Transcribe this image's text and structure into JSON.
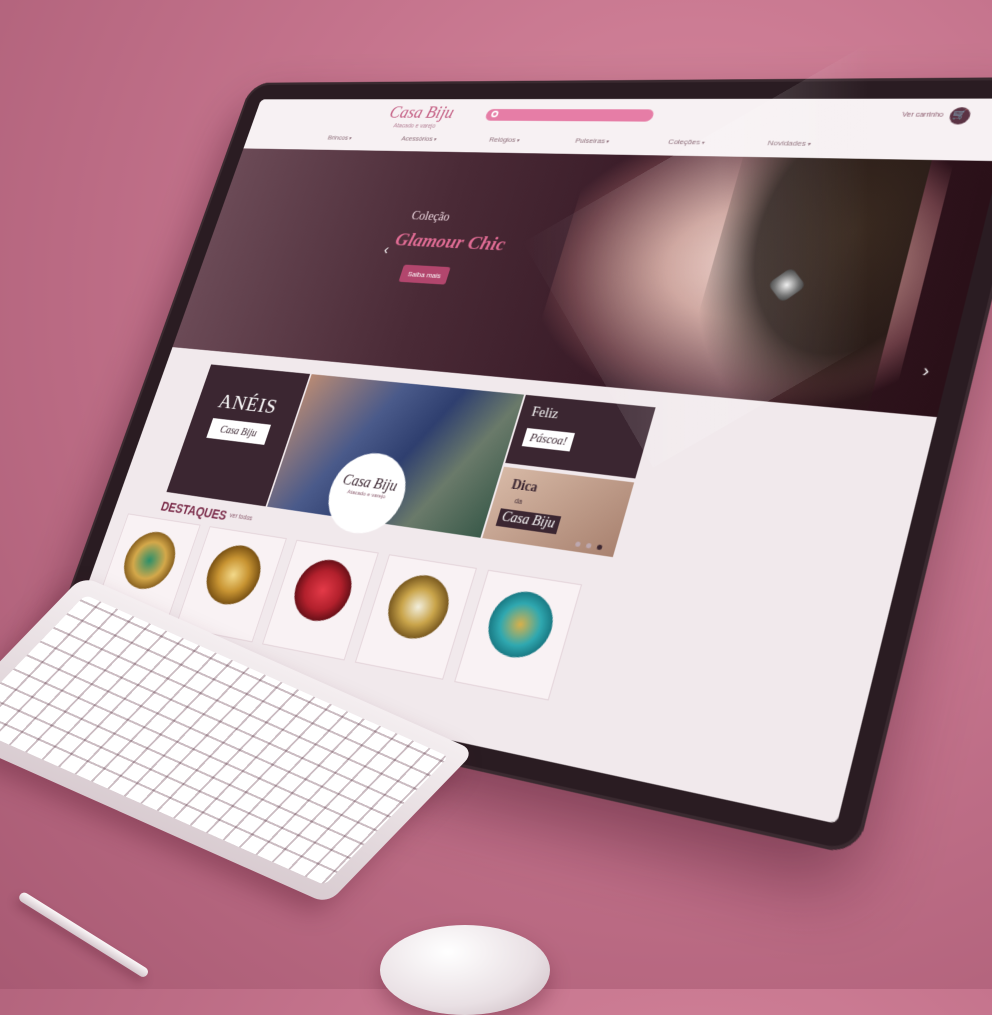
{
  "site": {
    "logo": "Casa Biju",
    "tagline": "Atacado e varejo",
    "cart_label": "Ver carrinho",
    "nav": [
      "Brincos",
      "Acessórios",
      "Relógios",
      "Pulseiras",
      "Coleções",
      "Novidades"
    ]
  },
  "hero": {
    "collection_title": "Coleção",
    "collection_name": "Glamour Chic",
    "cta_label": "Saiba mais"
  },
  "banners": {
    "aneis_title": "ANÉIS",
    "aneis_sub": "Casa Biju",
    "casa_title": "Casa Biju",
    "casa_sub": "Atacado e varejo",
    "pascoa_line1": "Feliz",
    "pascoa_line2": "Páscoa!",
    "dica_line1": "Dica",
    "dica_line2": "da",
    "dica_line3": "Casa Biju"
  },
  "destaques": {
    "title": "DESTAQUES",
    "link": "ver todos",
    "products": [
      {
        "kind": "ring-set",
        "accent": "#2b8f6a"
      },
      {
        "kind": "gold-necklace",
        "accent": "#c89432"
      },
      {
        "kind": "red-necklace",
        "accent": "#e43a48"
      },
      {
        "kind": "cream-necklace",
        "accent": "#c9a44a"
      },
      {
        "kind": "turquoise-necklace",
        "accent": "#2fa8b0"
      }
    ]
  },
  "colors": {
    "brand_pink": "#e67da6",
    "brand_dark": "#3b2631",
    "accent_red": "#b2466d",
    "background": "#c4738c"
  }
}
